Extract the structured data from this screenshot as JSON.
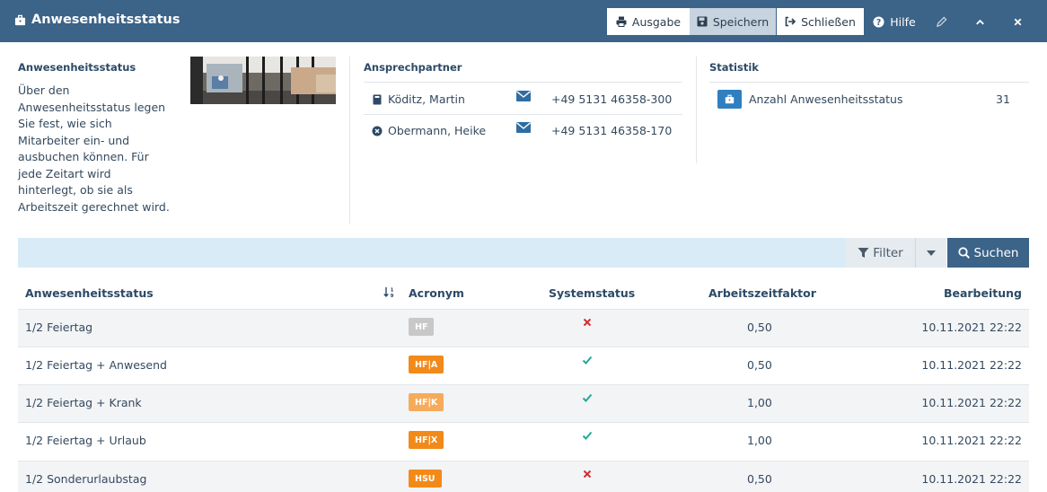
{
  "header": {
    "title": "Anwesenheitsstatus",
    "buttons": {
      "output": "Ausgabe",
      "save": "Speichern",
      "close": "Schließen",
      "help": "Hilfe"
    }
  },
  "info": {
    "title": "Anwesenheitsstatus",
    "description": "Über den Anwesenheitsstatus legen Sie fest, wie sich Mitarbeiter ein- und ausbuchen können. Für jede Zeitart wird hinterlegt, ob sie als Arbeitszeit gerechnet wird."
  },
  "contacts": {
    "title": "Ansprechpartner",
    "items": [
      {
        "name": "Köditz, Martin",
        "phone": "+49 5131 46358-300"
      },
      {
        "name": "Obermann, Heike",
        "phone": "+49 5131 46358-170"
      }
    ]
  },
  "stats": {
    "title": "Statistik",
    "label": "Anzahl Anwesenheitsstatus",
    "value": "31"
  },
  "search": {
    "filter_label": "Filter",
    "search_label": "Suchen"
  },
  "table": {
    "headers": {
      "name": "Anwesenheitsstatus",
      "acronym": "Acronym",
      "system": "Systemstatus",
      "factor": "Arbeitszeitfaktor",
      "edited": "Bearbeitung"
    },
    "rows": [
      {
        "name": "1/2 Feiertag",
        "acronym": "HF",
        "acronym_color": "#c8c8c8",
        "system": false,
        "factor": "0,50",
        "edited": "10.11.2021 22:22"
      },
      {
        "name": "1/2 Feiertag + Anwesend",
        "acronym": "HF|A",
        "acronym_color": "#f28a1a",
        "system": true,
        "factor": "0,50",
        "edited": "10.11.2021 22:22"
      },
      {
        "name": "1/2 Feiertag + Krank",
        "acronym": "HF|K",
        "acronym_color": "#f5ab5a",
        "system": true,
        "factor": "1,00",
        "edited": "10.11.2021 22:22"
      },
      {
        "name": "1/2 Feiertag + Urlaub",
        "acronym": "HF|X",
        "acronym_color": "#f28a1a",
        "system": true,
        "factor": "1,00",
        "edited": "10.11.2021 22:22"
      },
      {
        "name": "1/2 Sonderurlaubstag",
        "acronym": "HSU",
        "acronym_color": "#f28a1a",
        "system": false,
        "factor": "0,50",
        "edited": "10.11.2021 22:22"
      }
    ]
  },
  "colors": {
    "header_bg": "#3c6388",
    "check": "#26a69a",
    "cross": "#d32f2f"
  },
  "icons": {
    "briefcase": "briefcase-icon",
    "print": "print-icon",
    "save": "save-icon",
    "signout": "sign-out-icon",
    "help": "question-circle-icon",
    "edit": "pencil-icon",
    "collapse": "chevron-up-icon",
    "close": "close-icon",
    "book": "address-book-icon",
    "times_circle": "times-circle-icon",
    "mail": "envelope-icon",
    "filter": "filter-icon",
    "search": "search-icon",
    "sort": "sort-icon"
  }
}
